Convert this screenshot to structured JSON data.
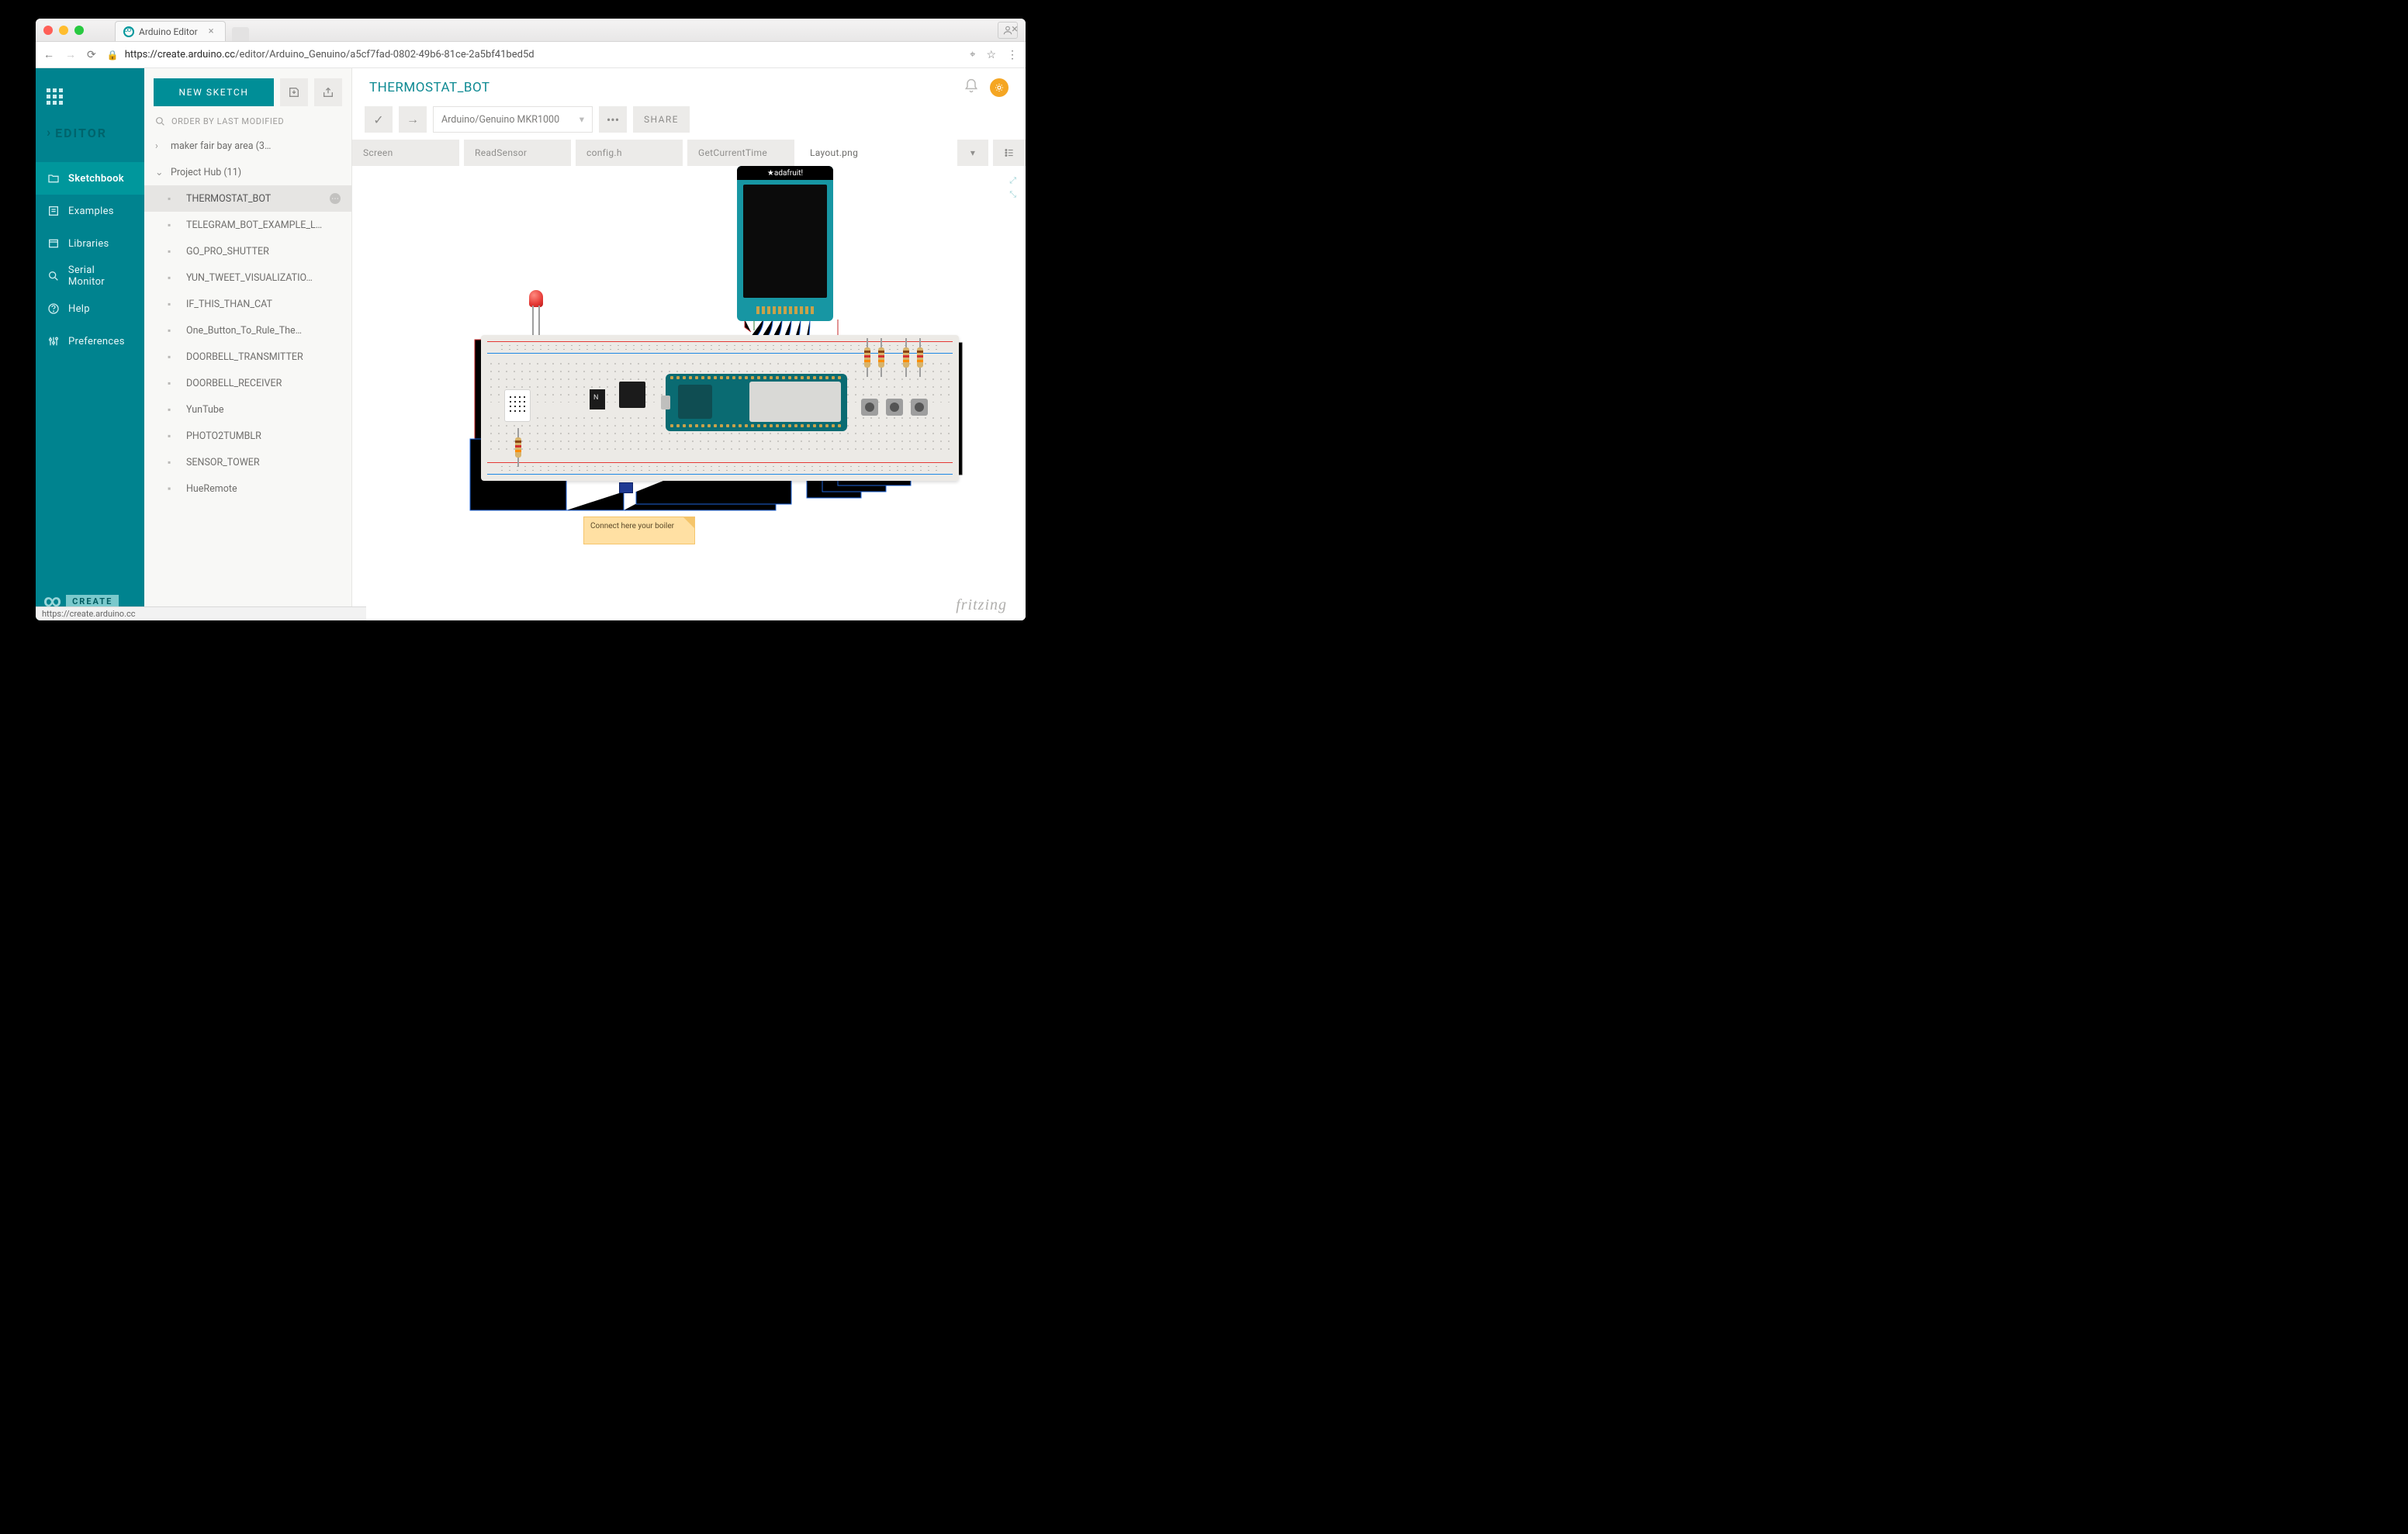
{
  "browser": {
    "tab_title": "Arduino Editor",
    "url_origin": "https://create.arduino.cc",
    "url_path": "/editor/Arduino_Genuino/a5cf7fad-0802-49b6-81ce-2a5bf41bed5d",
    "status_text": "https://create.arduino.cc"
  },
  "nav": {
    "title": "EDITOR",
    "items": [
      "Sketchbook",
      "Examples",
      "Libraries",
      "Serial Monitor",
      "Help",
      "Preferences"
    ],
    "create_label": "CREATE"
  },
  "sketchpanel": {
    "new_button": "NEW SKETCH",
    "order_label": "ORDER BY LAST MODIFIED",
    "folders": [
      {
        "name": "maker fair bay area (3…",
        "open": false
      },
      {
        "name": "Project Hub (11)",
        "open": true,
        "children": [
          "THERMOSTAT_BOT",
          "TELEGRAM_BOT_EXAMPLE_L…",
          "GO_PRO_SHUTTER",
          "YUN_TWEET_VISUALIZATIO…",
          "IF_THIS_THAN_CAT",
          "One_Button_To_Rule_The…",
          "DOORBELL_TRANSMITTER",
          "DOORBELL_RECEIVER",
          "YunTube",
          "PHOTO2TUMBLR",
          "SENSOR_TOWER"
        ]
      },
      {
        "name": "HueRemote",
        "open": false,
        "leaf": true
      }
    ],
    "selected": "THERMOSTAT_BOT"
  },
  "main": {
    "project_title": "THERMOSTAT_BOT",
    "board": "Arduino/Genuino MKR1000",
    "share": "SHARE",
    "tabs": [
      "Screen",
      "ReadSensor",
      "config.h",
      "GetCurrentTime",
      "Layout.png"
    ],
    "active_tab": "Layout.png"
  },
  "layout": {
    "display_header": "★adafruit!",
    "note": "Connect here your boiler",
    "credit": "fritzing"
  }
}
